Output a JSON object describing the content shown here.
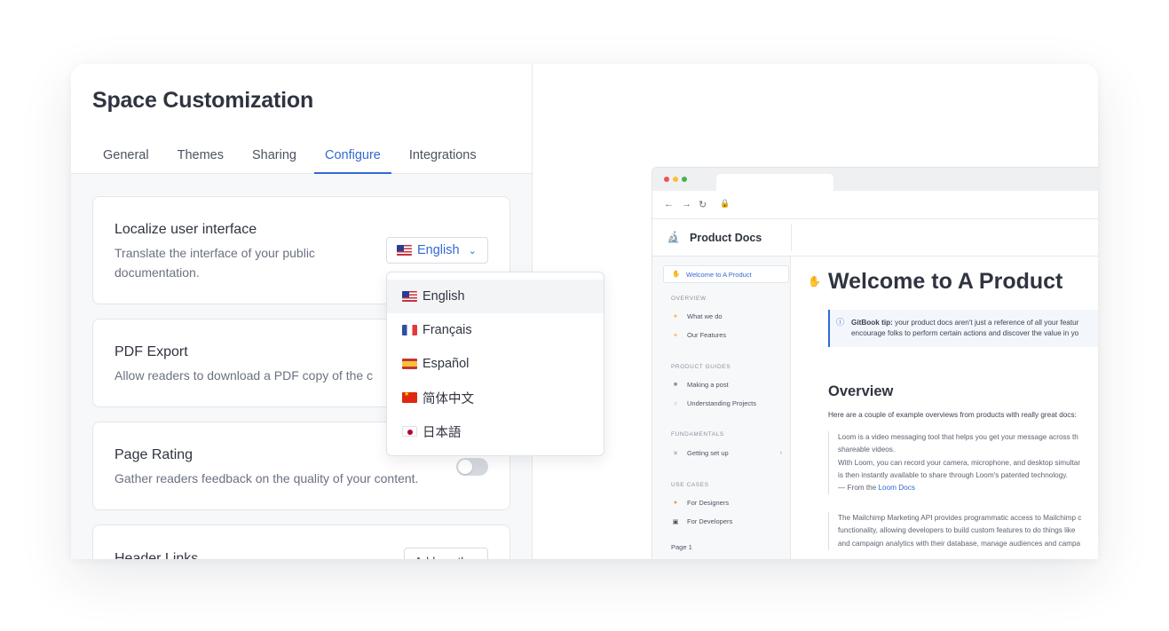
{
  "panel": {
    "title": "Space Customization",
    "tabs": [
      "General",
      "Themes",
      "Sharing",
      "Configure",
      "Integrations"
    ],
    "active_tab": "Configure"
  },
  "sections": {
    "localize": {
      "title": "Localize user interface",
      "desc_line1": "Translate the interface of your public",
      "desc_line2": "documentation.",
      "selected_language": "English"
    },
    "pdf": {
      "title": "PDF Export",
      "desc": "Allow readers to download a PDF copy of the c"
    },
    "rating": {
      "title": "Page Rating",
      "desc": "Gather readers feedback on the quality of your content.",
      "enabled": false
    },
    "header_links": {
      "title": "Header Links",
      "button": "Add another"
    }
  },
  "language_dropdown": {
    "options": [
      {
        "label": "English",
        "flag": "us-flag"
      },
      {
        "label": "Français",
        "flag": "fr-flag"
      },
      {
        "label": "Español",
        "flag": "es-flag"
      },
      {
        "label": "简体中文",
        "flag": "cn-flag"
      },
      {
        "label": "日本語",
        "flag": "jp-flag"
      }
    ],
    "highlighted": "English"
  },
  "preview": {
    "site_name": "Product Docs",
    "sidebar": {
      "active": "Welcome to A Product",
      "overview_label": "OVERVIEW",
      "overview_items": [
        "What we do",
        "Our Features"
      ],
      "guides_label": "PRODUCT GUIDES",
      "guides_items": [
        "Making a post",
        "Understanding Projects"
      ],
      "fundamentals_label": "FUNDAMENTALS",
      "fundamentals_items": [
        "Getting set up"
      ],
      "usecases_label": "USE CASES",
      "usecases_items": [
        "For Designers",
        "For Developers"
      ],
      "page1": "Page 1"
    },
    "content": {
      "h1": "Welcome to A Product",
      "tip_bold": "GitBook tip:",
      "tip_line1": " your product docs aren't just a reference of all your featur",
      "tip_line2": "encourage folks to perform certain actions and discover the value in yo",
      "h2": "Overview",
      "intro": "Here are a couple of example overviews from products with really great docs:",
      "quote1_line1": "Loom is a video messaging tool that helps you get your message across th",
      "quote1_line2": "shareable videos.",
      "quote1_line3": "With Loom, you can record your camera, microphone, and desktop simultar",
      "quote1_line4": "is then instantly available to share through Loom's patented technology.",
      "quote1_from": "— From the ",
      "quote1_link": "Loom Docs",
      "quote2_line1": "The Mailchimp Marketing API provides programmatic access to Mailchimp c",
      "quote2_line2": "functionality, allowing developers to build custom features to do things like",
      "quote2_line3": "and campaign analytics with their database, manage audiences and campa"
    }
  },
  "colors": {
    "accent": "#3469d4",
    "text": "#2f3440",
    "muted": "#6a7180",
    "border": "#e3e5e9",
    "panel_bg": "#f7f8fa"
  }
}
